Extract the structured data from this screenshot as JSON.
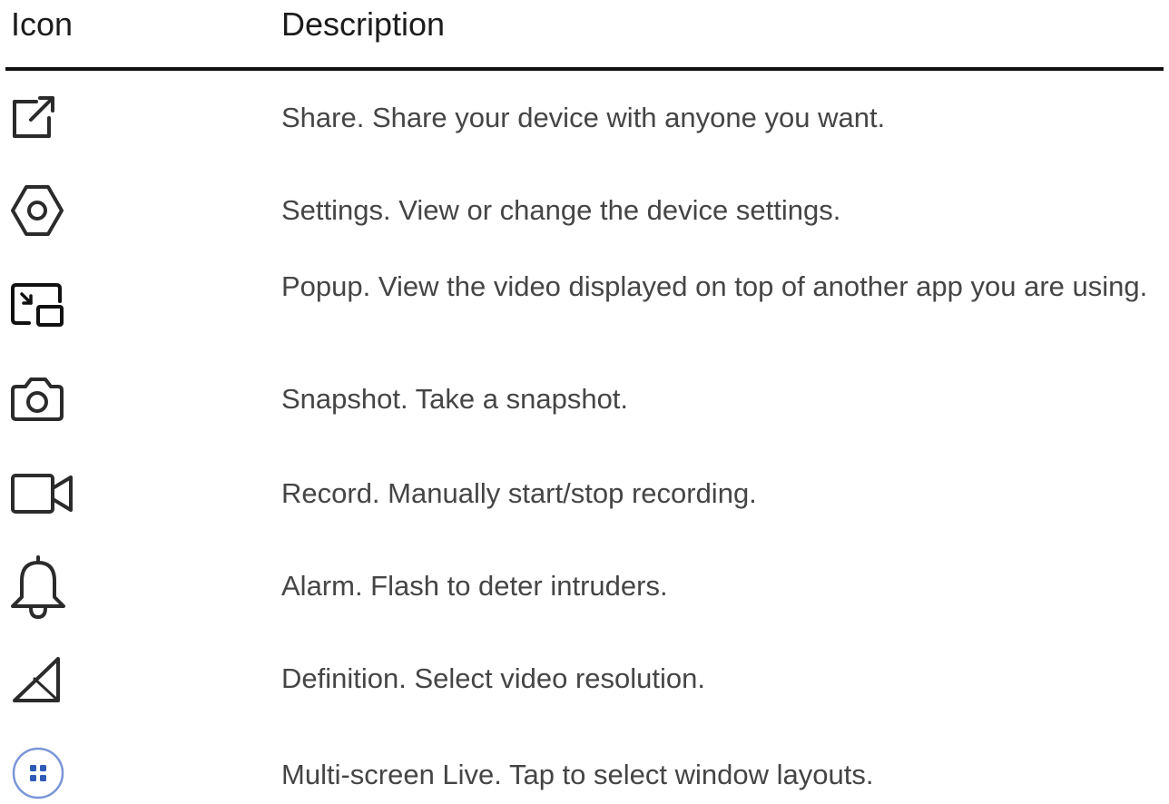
{
  "table": {
    "headers": {
      "icon": "Icon",
      "description": "Description"
    },
    "rows": [
      {
        "icon": "share-icon",
        "description": "Share. Share your device with anyone you want."
      },
      {
        "icon": "settings-hexagon-icon",
        "description": "Settings. View or change the device settings."
      },
      {
        "icon": "popup-pip-icon",
        "description": "Popup. View the video displayed on top of another app you are using."
      },
      {
        "icon": "camera-icon",
        "description": "Snapshot. Take a snapshot."
      },
      {
        "icon": "video-camera-icon",
        "description": "Record. Manually start/stop recording."
      },
      {
        "icon": "bell-icon",
        "description": "Alarm. Flash to deter intruders."
      },
      {
        "icon": "signal-triangle-icon",
        "description": "Definition. Select video resolution."
      },
      {
        "icon": "grid-circle-icon",
        "description": "Multi-screen Live. Tap to select window layouts."
      }
    ]
  },
  "colors": {
    "text": "#454545",
    "header_text": "#1c1c1c",
    "rule": "#111111",
    "icon_stroke": "#2b2b2b",
    "multi_screen_accent": "#2f5bb7"
  }
}
